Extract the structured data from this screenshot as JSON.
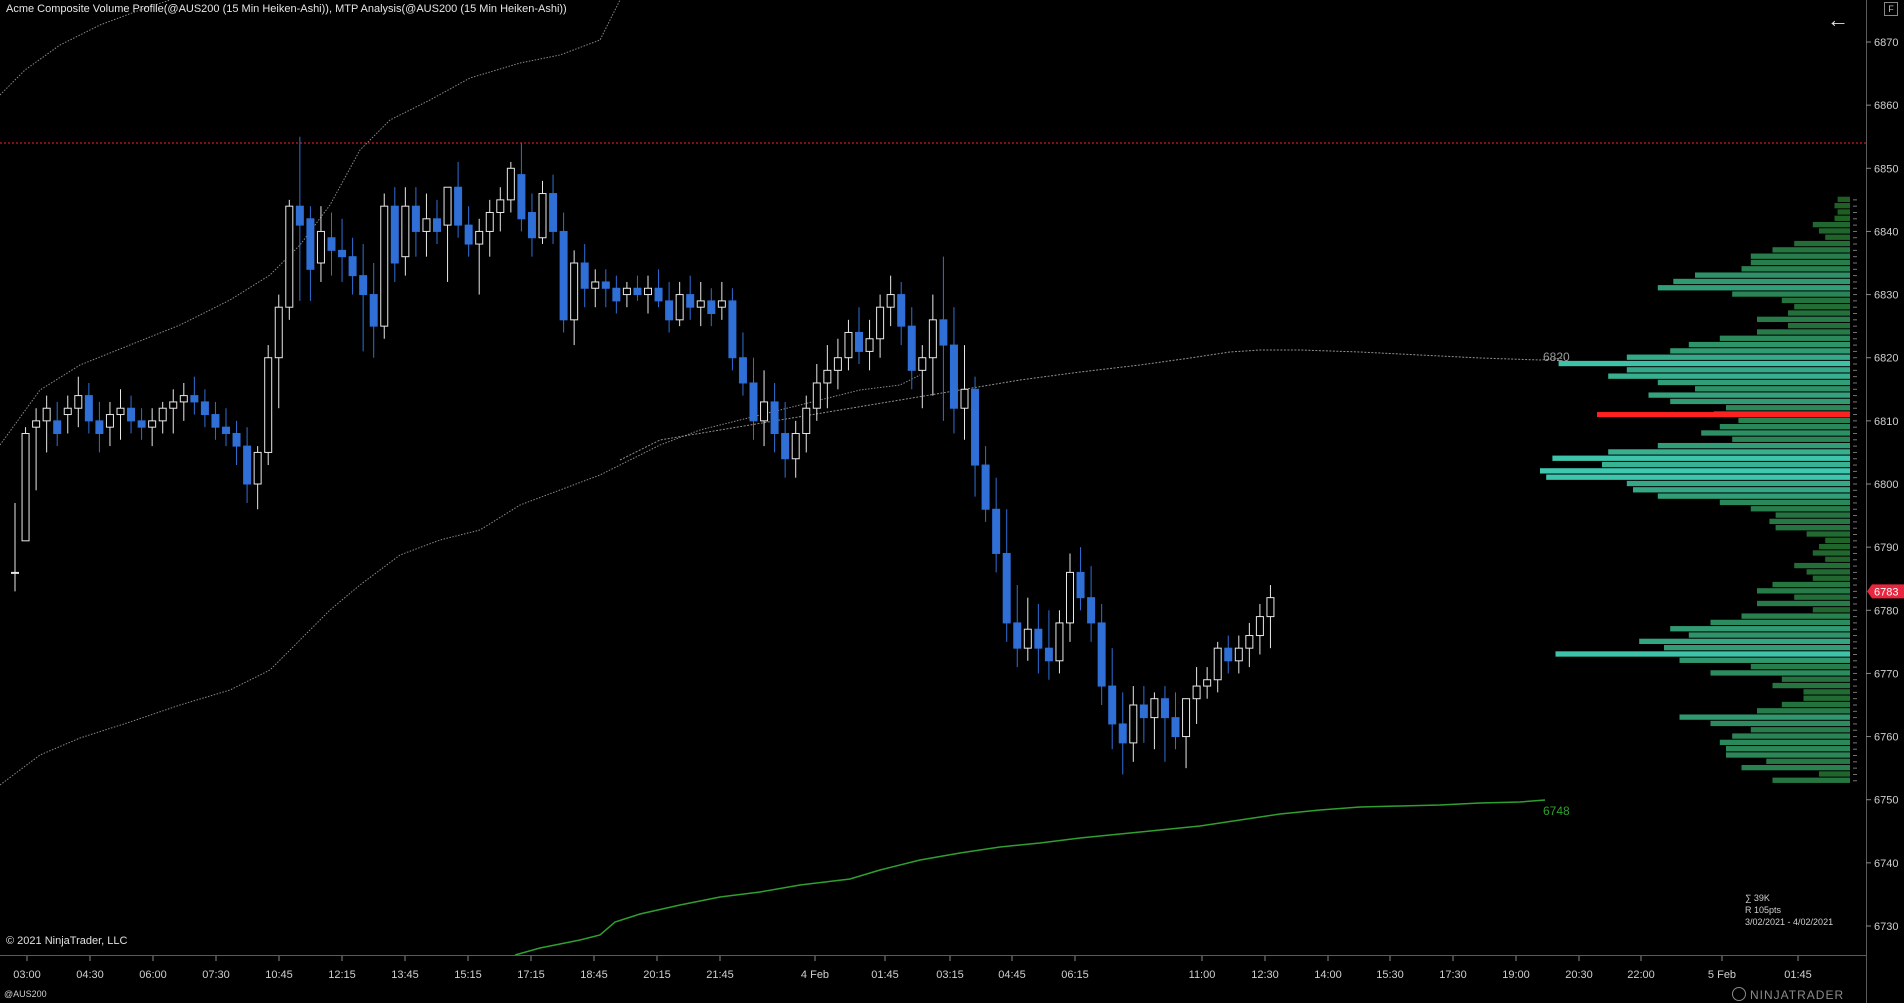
{
  "header": {
    "title": "Acme Composite Volume Profile(@AUS200 (15 Min Heiken-Ashi)), MTP Analysis(@AUS200 (15 Min Heiken-Ashi))"
  },
  "corner_button_label": "F",
  "copyright": "© 2021 NinjaTrader, LLC",
  "instrument": "@AUS200",
  "brand": "NINJATRADER",
  "volume_profile_stats": {
    "total": "∑ 39K",
    "range": "R 105pts",
    "dates": "3/02/2021 - 4/02/2021"
  },
  "colors": {
    "background": "#000000",
    "candle_up": "#e8e8e8",
    "candle_down": "#2f6fd6",
    "band": "#8a8a8a",
    "vwap": "#909090",
    "green_line": "#2fa02f",
    "resistance": "#ff2020",
    "price_marker": "#e8263f",
    "profile_high": "#3fc8b0",
    "profile_low": "#1d5a1d"
  },
  "chart_data": {
    "type": "candlestick",
    "instrument": "@AUS200",
    "timeframe": "15 Min Heiken-Ashi",
    "yaxis": {
      "min": 6727,
      "max": 6873,
      "ticks": [
        6870,
        6860,
        6850,
        6840,
        6830,
        6820,
        6810,
        6800,
        6790,
        6780,
        6770,
        6760,
        6750,
        6740,
        6730
      ]
    },
    "xaxis": {
      "tick_labels": [
        "03:00",
        "04:30",
        "06:00",
        "07:30",
        "10:45",
        "12:15",
        "13:45",
        "15:15",
        "17:15",
        "18:45",
        "20:15",
        "21:45",
        "4 Feb",
        "01:45",
        "03:15",
        "04:45",
        "06:15",
        "11:00",
        "12:30",
        "14:00",
        "15:30",
        "17:30",
        "19:00",
        "20:30",
        "22:00",
        "5 Feb",
        "01:45"
      ]
    },
    "last_price": 6783,
    "resistance_level": 6854,
    "annotations": [
      {
        "label": "6820",
        "value": 6820
      },
      {
        "label": "6748",
        "value": 6748
      }
    ],
    "candles": [
      [
        6786,
        6797,
        6783,
        6786
      ],
      [
        6791,
        6809,
        6793,
        6808
      ],
      [
        6809,
        6812,
        6799,
        6810
      ],
      [
        6810,
        6814,
        6805,
        6812
      ],
      [
        6810,
        6813,
        6806,
        6808
      ],
      [
        6811,
        6814,
        6808,
        6812
      ],
      [
        6812,
        6817,
        6809,
        6814
      ],
      [
        6814,
        6816,
        6808,
        6810
      ],
      [
        6810,
        6813,
        6805,
        6808
      ],
      [
        6809,
        6813,
        6806,
        6811
      ],
      [
        6811,
        6815,
        6807,
        6812
      ],
      [
        6812,
        6814,
        6808,
        6810
      ],
      [
        6810,
        6812,
        6807,
        6809
      ],
      [
        6809,
        6812,
        6806,
        6810
      ],
      [
        6810,
        6813,
        6808,
        6812
      ],
      [
        6812,
        6815,
        6808,
        6813
      ],
      [
        6813,
        6816,
        6810,
        6814
      ],
      [
        6814,
        6817,
        6811,
        6813
      ],
      [
        6813,
        6815,
        6809,
        6811
      ],
      [
        6811,
        6813,
        6807,
        6809
      ],
      [
        6809,
        6812,
        6806,
        6808
      ],
      [
        6808,
        6810,
        6803,
        6806
      ],
      [
        6806,
        6809,
        6797,
        6800
      ],
      [
        6800,
        6806,
        6796,
        6805
      ],
      [
        6805,
        6822,
        6803,
        6820
      ],
      [
        6820,
        6830,
        6812,
        6828
      ],
      [
        6828,
        6845,
        6826,
        6844
      ],
      [
        6844,
        6855,
        6829,
        6841
      ],
      [
        6842,
        6844,
        6829,
        6834
      ],
      [
        6835,
        6844,
        6832,
        6840
      ],
      [
        6839,
        6843,
        6833,
        6837
      ],
      [
        6837,
        6842,
        6832,
        6836
      ],
      [
        6836,
        6839,
        6830,
        6833
      ],
      [
        6833,
        6838,
        6821,
        6830
      ],
      [
        6830,
        6835,
        6820,
        6825
      ],
      [
        6825,
        6846,
        6823,
        6844
      ],
      [
        6844,
        6847,
        6832,
        6835
      ],
      [
        6836,
        6847,
        6833,
        6844
      ],
      [
        6844,
        6847,
        6836,
        6840
      ],
      [
        6840,
        6846,
        6836,
        6842
      ],
      [
        6842,
        6845,
        6838,
        6840
      ],
      [
        6841,
        6846,
        6832,
        6847
      ],
      [
        6847,
        6851,
        6839,
        6841
      ],
      [
        6841,
        6844,
        6836,
        6838
      ],
      [
        6838,
        6842,
        6830,
        6840
      ],
      [
        6840,
        6845,
        6836,
        6843
      ],
      [
        6843,
        6847,
        6840,
        6845
      ],
      [
        6845,
        6851,
        6843,
        6850
      ],
      [
        6849,
        6854,
        6840,
        6842
      ],
      [
        6843,
        6846,
        6836,
        6839
      ],
      [
        6839,
        6848,
        6838,
        6846
      ],
      [
        6846,
        6849,
        6838,
        6840
      ],
      [
        6840,
        6843,
        6824,
        6826
      ],
      [
        6826,
        6837,
        6822,
        6835
      ],
      [
        6835,
        6838,
        6828,
        6831
      ],
      [
        6831,
        6834,
        6828,
        6832
      ],
      [
        6832,
        6834,
        6828,
        6831
      ],
      [
        6831,
        6833,
        6827,
        6829
      ],
      [
        6830,
        6832,
        6828,
        6831
      ],
      [
        6831,
        6833,
        6829,
        6830
      ],
      [
        6830,
        6833,
        6827,
        6831
      ],
      [
        6831,
        6834,
        6828,
        6829
      ],
      [
        6829,
        6832,
        6824,
        6826
      ],
      [
        6826,
        6832,
        6825,
        6830
      ],
      [
        6830,
        6833,
        6826,
        6828
      ],
      [
        6828,
        6832,
        6825,
        6829
      ],
      [
        6829,
        6831,
        6825,
        6827
      ],
      [
        6828,
        6832,
        6826,
        6829
      ],
      [
        6829,
        6831,
        6818,
        6820
      ],
      [
        6820,
        6824,
        6814,
        6816
      ],
      [
        6816,
        6820,
        6807,
        6810
      ],
      [
        6810,
        6818,
        6806,
        6813
      ],
      [
        6813,
        6816,
        6805,
        6808
      ],
      [
        6808,
        6813,
        6801,
        6804
      ],
      [
        6804,
        6810,
        6801,
        6808
      ],
      [
        6808,
        6814,
        6805,
        6812
      ],
      [
        6812,
        6819,
        6810,
        6816
      ],
      [
        6816,
        6822,
        6812,
        6818
      ],
      [
        6818,
        6823,
        6815,
        6820
      ],
      [
        6820,
        6826,
        6818,
        6824
      ],
      [
        6824,
        6828,
        6819,
        6821
      ],
      [
        6821,
        6826,
        6818,
        6823
      ],
      [
        6823,
        6830,
        6820,
        6828
      ],
      [
        6828,
        6833,
        6825,
        6830
      ],
      [
        6830,
        6832,
        6822,
        6825
      ],
      [
        6825,
        6828,
        6815,
        6818
      ],
      [
        6818,
        6822,
        6812,
        6820
      ],
      [
        6820,
        6830,
        6814,
        6826
      ],
      [
        6826,
        6836,
        6810,
        6822
      ],
      [
        6822,
        6828,
        6808,
        6812
      ],
      [
        6812,
        6822,
        6807,
        6815
      ],
      [
        6815,
        6817,
        6798,
        6803
      ],
      [
        6803,
        6806,
        6794,
        6796
      ],
      [
        6796,
        6801,
        6786,
        6789
      ],
      [
        6789,
        6796,
        6775,
        6778
      ],
      [
        6778,
        6784,
        6771,
        6774
      ],
      [
        6774,
        6782,
        6772,
        6777
      ],
      [
        6777,
        6781,
        6770,
        6774
      ],
      [
        6774,
        6780,
        6769,
        6772
      ],
      [
        6772,
        6780,
        6770,
        6778
      ],
      [
        6778,
        6789,
        6775,
        6786
      ],
      [
        6786,
        6790,
        6780,
        6782
      ],
      [
        6782,
        6787,
        6775,
        6778
      ],
      [
        6778,
        6781,
        6765,
        6768
      ],
      [
        6768,
        6774,
        6758,
        6762
      ],
      [
        6762,
        6767,
        6754,
        6759
      ],
      [
        6759,
        6768,
        6756,
        6765
      ],
      [
        6765,
        6768,
        6759,
        6763
      ],
      [
        6763,
        6767,
        6758,
        6766
      ],
      [
        6766,
        6768,
        6756,
        6763
      ],
      [
        6763,
        6767,
        6758,
        6760
      ],
      [
        6760,
        6766,
        6755,
        6766
      ],
      [
        6766,
        6771,
        6762,
        6768
      ],
      [
        6768,
        6771,
        6766,
        6769
      ],
      [
        6769,
        6775,
        6767,
        6774
      ],
      [
        6774,
        6776,
        6770,
        6772
      ],
      [
        6772,
        6776,
        6770,
        6774
      ],
      [
        6774,
        6778,
        6771,
        6776
      ],
      [
        6776,
        6781,
        6773,
        6779
      ],
      [
        6779,
        6784,
        6774,
        6782
      ]
    ],
    "volume_profile": {
      "start": 6753,
      "step": 1,
      "levels": [
        0.25,
        0.1,
        0.35,
        0.27,
        0.4,
        0.4,
        0.42,
        0.38,
        0.32,
        0.45,
        0.55,
        0.3,
        0.22,
        0.15,
        0.15,
        0.25,
        0.22,
        0.45,
        0.32,
        0.55,
        0.95,
        0.6,
        0.68,
        0.52,
        0.58,
        0.45,
        0.35,
        0.12,
        0.3,
        0.18,
        0.3,
        0.25,
        0.12,
        0.14,
        0.18,
        0.08,
        0.12,
        0.1,
        0.08,
        0.14,
        0.24,
        0.26,
        0.24,
        0.32,
        0.42,
        0.62,
        0.7,
        0.72,
        0.98,
        1.0,
        0.8,
        0.96,
        0.78,
        0.62,
        0.38,
        0.48,
        0.42,
        0.36,
        0.44,
        0.4,
        0.58,
        0.65,
        0.5,
        0.62,
        0.78,
        0.72,
        0.94,
        0.72,
        0.58,
        0.52,
        0.42,
        0.3,
        0.2,
        0.3,
        0.2,
        0.18,
        0.22,
        0.38,
        0.62,
        0.57,
        0.5,
        0.35,
        0.32,
        0.32,
        0.25,
        0.18,
        0.08,
        0.1,
        0.12,
        0.05,
        0.04,
        0.05,
        0.04
      ],
      "poc": 6811
    }
  }
}
